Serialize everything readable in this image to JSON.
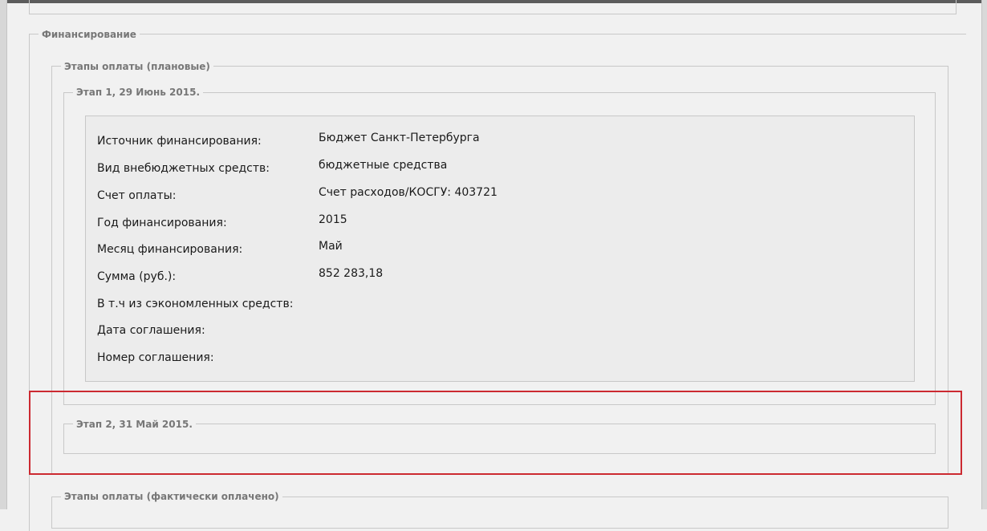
{
  "financing": {
    "title": "Финансирование",
    "planned": {
      "title": "Этапы оплаты (плановые)",
      "stages": [
        {
          "title": "Этап 1, 29 Июнь 2015.",
          "fields": [
            {
              "label": "Источник финансирования:",
              "value": "Бюджет Санкт-Петербурга"
            },
            {
              "label": "Вид внебюджетных средств:",
              "value": "бюджетные средства"
            },
            {
              "label": "Счет оплаты:",
              "value": "Счет расходов/КОСГУ: 403721"
            },
            {
              "label": "Год финансирования:",
              "value": "2015"
            },
            {
              "label": "Месяц финансирования:",
              "value": "Май"
            },
            {
              "label": "Сумма (руб.):",
              "value": "852 283,18"
            },
            {
              "label": "В т.ч из сэкономленных средств:",
              "value": ""
            },
            {
              "label": "Дата соглашения:",
              "value": ""
            },
            {
              "label": "Номер соглашения:",
              "value": ""
            }
          ]
        },
        {
          "title": "Этап 2, 31 Май 2015.",
          "fields": []
        }
      ]
    },
    "actual": {
      "title": "Этапы оплаты (фактически оплачено)"
    }
  },
  "colors": {
    "highlight": "#cc2a31",
    "border": "#c8c8c8",
    "legend_text": "#777777"
  }
}
